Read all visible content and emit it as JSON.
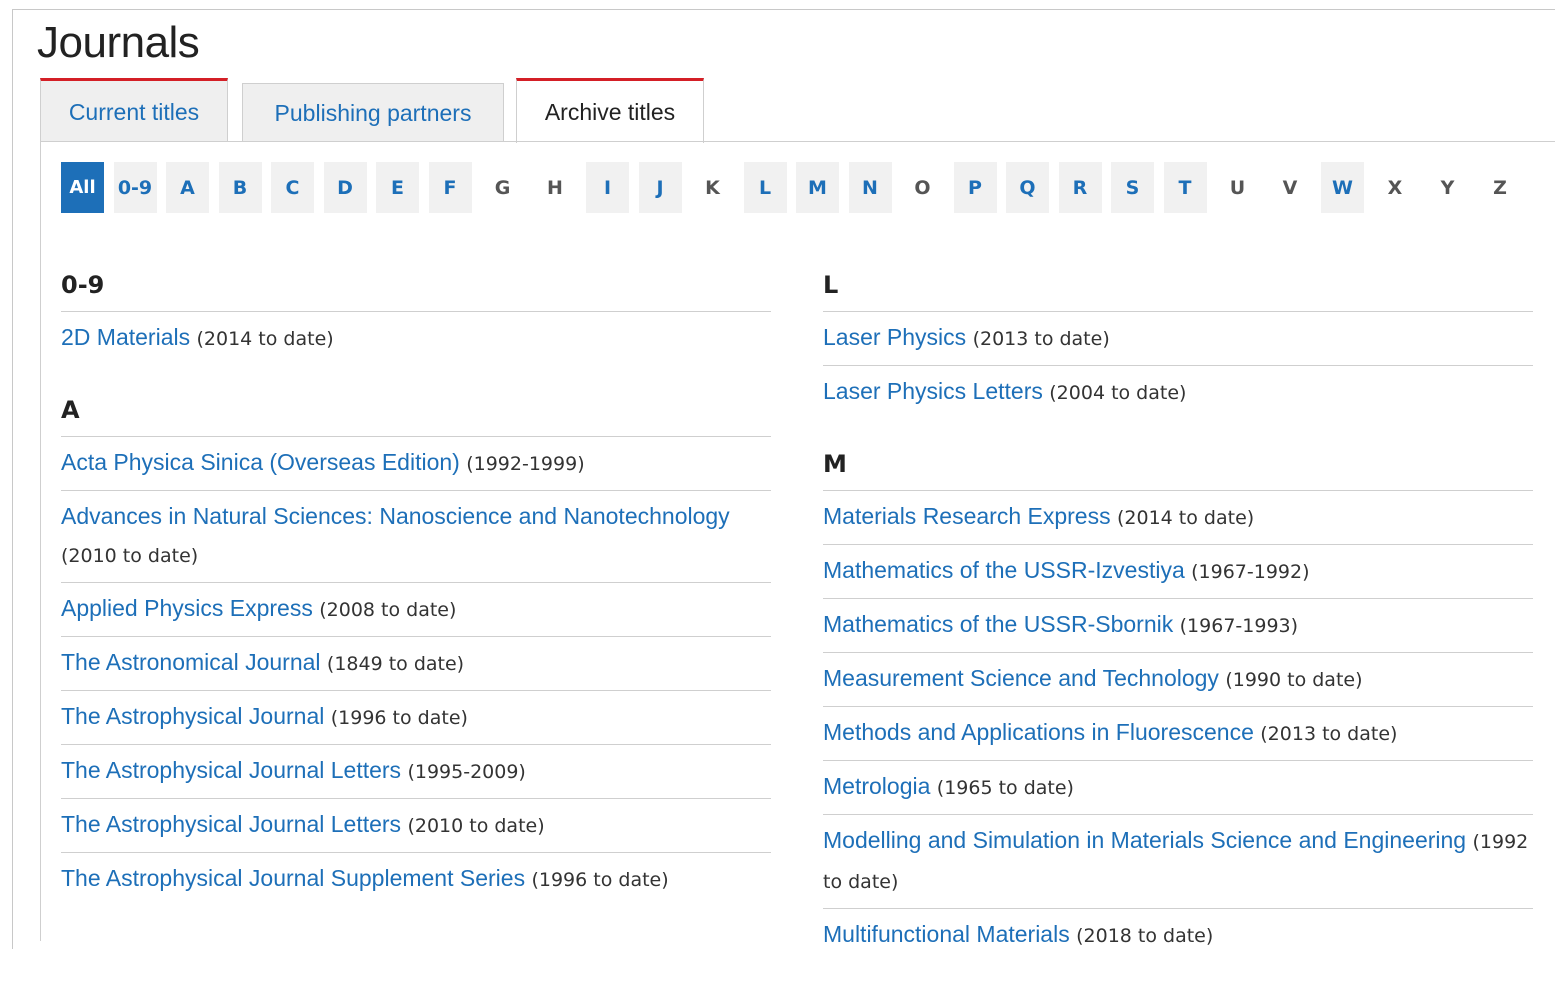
{
  "page": {
    "title": "Journals"
  },
  "tabs": [
    {
      "label": "Current titles",
      "active": false
    },
    {
      "label": "Publishing partners",
      "active": false
    },
    {
      "label": "Archive titles",
      "active": true
    }
  ],
  "alphabet": {
    "selected": "All",
    "letters": [
      {
        "label": "All",
        "enabled": true
      },
      {
        "label": "0-9",
        "enabled": true
      },
      {
        "label": "A",
        "enabled": true
      },
      {
        "label": "B",
        "enabled": true
      },
      {
        "label": "C",
        "enabled": true
      },
      {
        "label": "D",
        "enabled": true
      },
      {
        "label": "E",
        "enabled": true
      },
      {
        "label": "F",
        "enabled": true
      },
      {
        "label": "G",
        "enabled": false
      },
      {
        "label": "H",
        "enabled": false
      },
      {
        "label": "I",
        "enabled": true
      },
      {
        "label": "J",
        "enabled": true
      },
      {
        "label": "K",
        "enabled": false
      },
      {
        "label": "L",
        "enabled": true
      },
      {
        "label": "M",
        "enabled": true
      },
      {
        "label": "N",
        "enabled": true
      },
      {
        "label": "O",
        "enabled": false
      },
      {
        "label": "P",
        "enabled": true
      },
      {
        "label": "Q",
        "enabled": true
      },
      {
        "label": "R",
        "enabled": true
      },
      {
        "label": "S",
        "enabled": true
      },
      {
        "label": "T",
        "enabled": true
      },
      {
        "label": "U",
        "enabled": false
      },
      {
        "label": "V",
        "enabled": false
      },
      {
        "label": "W",
        "enabled": true
      },
      {
        "label": "X",
        "enabled": false
      },
      {
        "label": "Y",
        "enabled": false
      },
      {
        "label": "Z",
        "enabled": false
      }
    ]
  },
  "columns": {
    "left": [
      {
        "heading": "0-9",
        "journals": [
          {
            "title": "2D Materials",
            "years": "(2014 to date)"
          }
        ]
      },
      {
        "heading": "A",
        "journals": [
          {
            "title": "Acta Physica Sinica (Overseas Edition)",
            "years": "(1992-1999)"
          },
          {
            "title": "Advances in Natural Sciences: Nanoscience and Nanotechnology",
            "years": "(2010 to date)"
          },
          {
            "title": "Applied Physics Express",
            "years": "(2008 to date)"
          },
          {
            "title": "The Astronomical Journal",
            "years": "(1849 to date)"
          },
          {
            "title": "The Astrophysical Journal",
            "years": "(1996 to date)"
          },
          {
            "title": "The Astrophysical Journal Letters",
            "years": "(1995-2009)"
          },
          {
            "title": "The Astrophysical Journal Letters",
            "years": "(2010 to date)"
          },
          {
            "title": "The Astrophysical Journal Supplement Series",
            "years": "(1996 to date)"
          }
        ]
      }
    ],
    "right": [
      {
        "heading": "L",
        "journals": [
          {
            "title": "Laser Physics",
            "years": "(2013 to date)"
          },
          {
            "title": "Laser Physics Letters",
            "years": "(2004 to date)"
          }
        ]
      },
      {
        "heading": "M",
        "journals": [
          {
            "title": "Materials Research Express",
            "years": "(2014 to date)"
          },
          {
            "title": "Mathematics of the USSR-Izvestiya",
            "years": "(1967-1992)"
          },
          {
            "title": "Mathematics of the USSR-Sbornik",
            "years": "(1967-1993)"
          },
          {
            "title": "Measurement Science and Technology",
            "years": "(1990 to date)"
          },
          {
            "title": "Methods and Applications in Fluorescence",
            "years": "(2013 to date)"
          },
          {
            "title": "Metrologia",
            "years": "(1965 to date)"
          },
          {
            "title": "Modelling and Simulation in Materials Science and Engineering",
            "years": "(1992 to date)"
          },
          {
            "title": "Multifunctional Materials",
            "years": "(2018 to date)"
          }
        ]
      }
    ]
  },
  "colors": {
    "link": "#1d6fb8",
    "accent": "#d41f26",
    "selected_bg": "#1d6fb8"
  }
}
